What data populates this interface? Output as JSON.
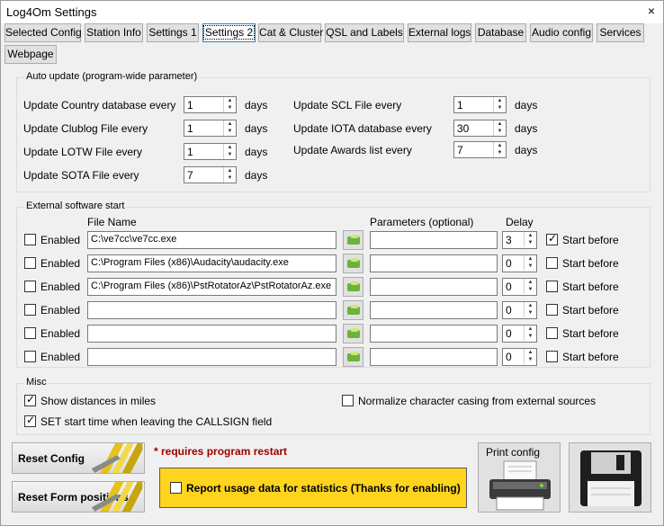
{
  "window": {
    "title": "Log4Om Settings",
    "close": "×"
  },
  "tabs": [
    {
      "label": "Selected Config"
    },
    {
      "label": "Station Info"
    },
    {
      "label": "Settings 1"
    },
    {
      "label": "Settings 2",
      "active": true
    },
    {
      "label": "Cat & Cluster"
    },
    {
      "label": "QSL and Labels"
    },
    {
      "label": "External logs"
    },
    {
      "label": "Database"
    },
    {
      "label": "Audio config"
    },
    {
      "label": "Services"
    },
    {
      "label": "Webpage"
    }
  ],
  "auto_update": {
    "title": "Auto update (program-wide parameter)",
    "units": "days",
    "left": [
      {
        "label": "Update Country database every",
        "value": "1"
      },
      {
        "label": "Update Clublog File every",
        "value": "1"
      },
      {
        "label": "Update LOTW File every",
        "value": "1"
      },
      {
        "label": "Update SOTA File every",
        "value": "7"
      }
    ],
    "right": [
      {
        "label": "Update SCL File every",
        "value": "1"
      },
      {
        "label": "Update IOTA database every",
        "value": "30"
      },
      {
        "label": "Update Awards list every",
        "value": "7"
      }
    ]
  },
  "external": {
    "title": "External software start",
    "col_file": "File Name",
    "col_params": "Parameters (optional)",
    "col_delay": "Delay",
    "enabled_label": "Enabled",
    "start_before_label": "Start before",
    "rows": [
      {
        "enabled": false,
        "file": "C:\\ve7cc\\ve7cc.exe",
        "params": "",
        "delay": "3",
        "start_before": true
      },
      {
        "enabled": false,
        "file": "C:\\Program Files (x86)\\Audacity\\audacity.exe",
        "params": "",
        "delay": "0",
        "start_before": false
      },
      {
        "enabled": false,
        "file": "C:\\Program Files (x86)\\PstRotatorAz\\PstRotatorAz.exe",
        "params": "",
        "delay": "0",
        "start_before": false
      },
      {
        "enabled": false,
        "file": "",
        "params": "",
        "delay": "0",
        "start_before": false
      },
      {
        "enabled": false,
        "file": "",
        "params": "",
        "delay": "0",
        "start_before": false
      },
      {
        "enabled": false,
        "file": "",
        "params": "",
        "delay": "0",
        "start_before": false
      }
    ]
  },
  "misc": {
    "title": "Misc",
    "show_miles": {
      "label": "Show distances in miles",
      "checked": true
    },
    "set_start_time": {
      "label": "SET start time when leaving the CALLSIGN field",
      "checked": true
    },
    "normalize_casing": {
      "label": "Normalize character casing from external sources",
      "checked": false
    }
  },
  "footer": {
    "reset_config": "Reset Config",
    "reset_form_positions": "Reset Form positions",
    "restart_notice": "* requires program restart",
    "report_usage": {
      "label": "Report usage data for statistics (Thanks for enabling)",
      "checked": false
    },
    "print_config": "Print config"
  },
  "colors": {
    "notice": "#a00000",
    "report_bg": "#ffd41f",
    "active_tab_border": "#3c7fb1"
  }
}
